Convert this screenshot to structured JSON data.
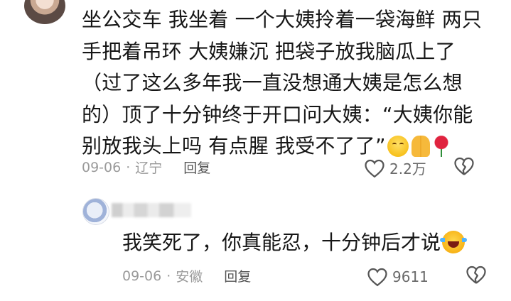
{
  "comment": {
    "lines": [
      "坐公交车 我坐着 一个大姨拎着一袋海鲜 两只",
      "手把着吊环 大姨嫌沉 把袋子放我脑瓜上了",
      "（过了这么多年我一直没想通大姨是怎么想",
      "的）顶了十分钟终于开口问大姨：“大姨你能",
      "别放我头上吗 有点腥 我受不了了”"
    ],
    "emojis": [
      "smiling-face",
      "folded-hands",
      "rose"
    ],
    "date": "09-06",
    "separator": "·",
    "location": "辽宁",
    "reply_label": "回复",
    "like_count": "2.2万"
  },
  "reply": {
    "text": "我笑死了，你真能忍，十分钟后才说",
    "emoji": "face-with-tears-of-joy",
    "date": "09-06",
    "separator": "·",
    "location": "安徽",
    "reply_label": "回复",
    "like_count": "9611"
  },
  "icons": {
    "like": "heart-icon",
    "dislike": "broken-heart-icon"
  }
}
